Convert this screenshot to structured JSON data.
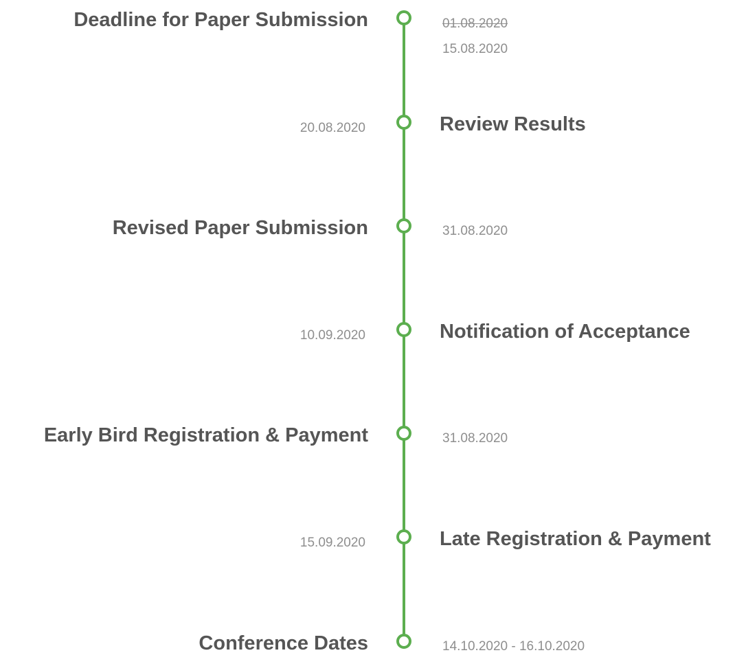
{
  "timeline": {
    "events": [
      {
        "title": "Deadline for Paper Submission",
        "old_date": "01.08.2020",
        "date": "15.08.2020"
      },
      {
        "title": "Review Results",
        "date": "20.08.2020"
      },
      {
        "title": "Revised Paper Submission",
        "date": "31.08.2020"
      },
      {
        "title": "Notification of Acceptance",
        "date": "10.09.2020"
      },
      {
        "title": "Early Bird Registration & Payment",
        "date": "31.08.2020"
      },
      {
        "title": "Late Registration & Payment",
        "date": "15.09.2020"
      },
      {
        "title": "Conference Dates",
        "date": "14.10.2020 - 16.10.2020"
      }
    ]
  }
}
